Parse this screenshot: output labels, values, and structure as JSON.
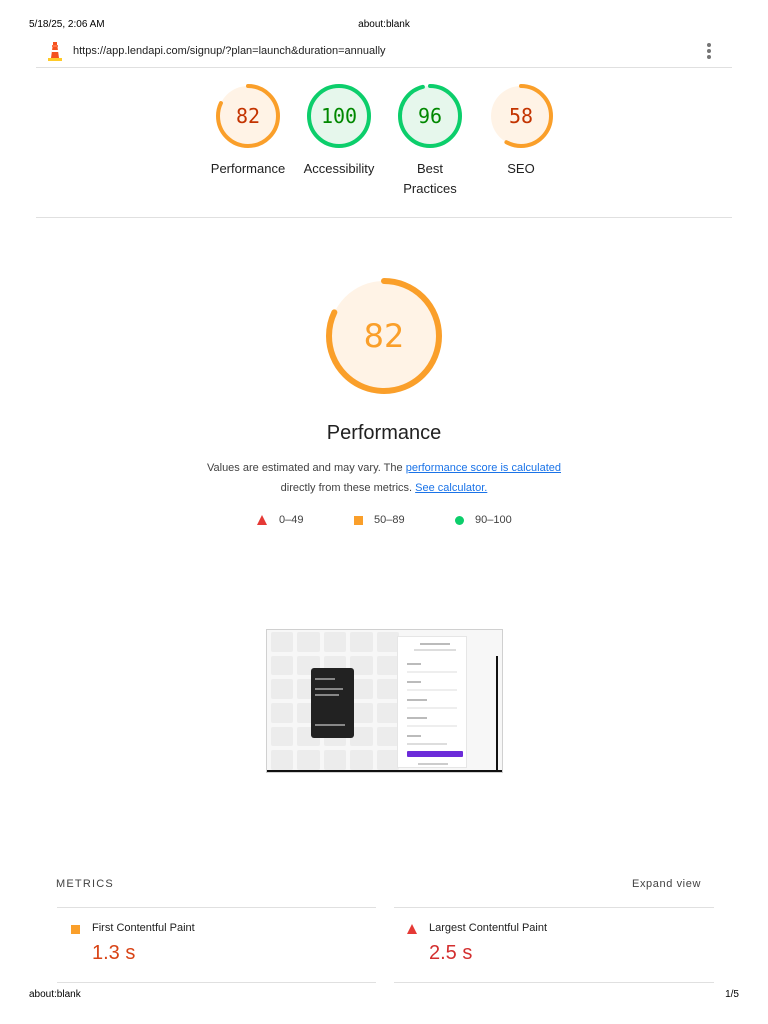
{
  "print_header": {
    "datetime": "5/18/25, 2:06 AM",
    "title": "about:blank"
  },
  "print_footer": {
    "url": "about:blank",
    "page": "1/5"
  },
  "topbar": {
    "url": "https://app.lendapi.com/signup/?plan=launch&duration=annually",
    "logo_icon": "lighthouse-icon",
    "menu_icon": "kebab-menu-icon"
  },
  "gauges": [
    {
      "score": "82",
      "label": "Performance",
      "fraction": 0.82,
      "color": "#fa9f2a",
      "bg": "#fff3e6",
      "text_color": "#c33300"
    },
    {
      "score": "100",
      "label": "Accessibility",
      "fraction": 1.0,
      "color": "#0cce6b",
      "bg": "#e6f7ec",
      "text_color": "#008800"
    },
    {
      "score": "96",
      "label": "Best Practices",
      "fraction": 0.96,
      "color": "#0cce6b",
      "bg": "#e6f7ec",
      "text_color": "#008800"
    },
    {
      "score": "58",
      "label": "SEO",
      "fraction": 0.58,
      "color": "#fa9f2a",
      "bg": "#fff3e6",
      "text_color": "#c33300"
    }
  ],
  "performance": {
    "score": "82",
    "fraction": 0.82,
    "title": "Performance",
    "desc_before": "Values are estimated and may vary. The ",
    "desc_link1": "performance score is calculated",
    "desc_middle": " directly from these metrics. ",
    "desc_link2": "See calculator."
  },
  "legend": {
    "fail": "0–49",
    "average": "50–89",
    "pass": "90–100"
  },
  "metrics": {
    "section_label": "METRICS",
    "expand_label": "Expand view",
    "items": [
      {
        "title": "First Contentful Paint",
        "value": "1.3 s"
      },
      {
        "title": "Largest Contentful Paint",
        "value": "2.5 s"
      }
    ]
  }
}
